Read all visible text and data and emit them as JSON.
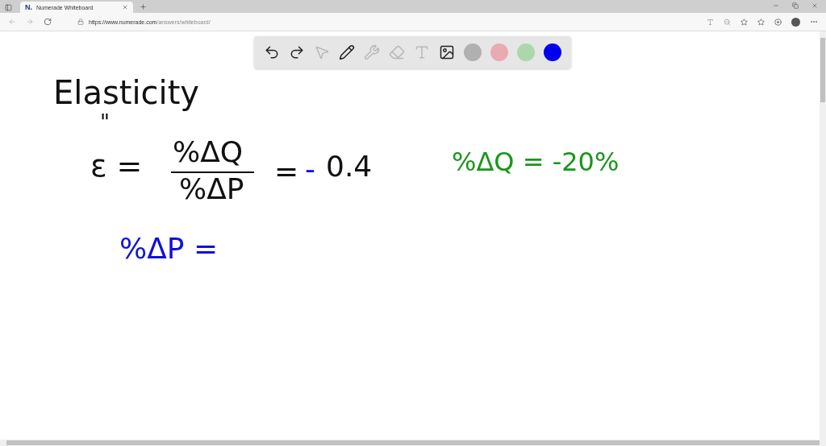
{
  "browser": {
    "tab": {
      "title": "Numerade Whiteboard",
      "logo": "N."
    },
    "url": {
      "host": "https://www.numerade.com",
      "path": "/answers/whiteboard/"
    }
  },
  "toolbar": {
    "tools": [
      {
        "kind": "undo",
        "disabled": false
      },
      {
        "kind": "redo",
        "disabled": false
      },
      {
        "kind": "select",
        "disabled": true
      },
      {
        "kind": "pen",
        "disabled": false
      },
      {
        "kind": "tools",
        "disabled": true
      },
      {
        "kind": "eraser",
        "disabled": true
      },
      {
        "kind": "text",
        "disabled": true
      },
      {
        "kind": "image",
        "disabled": false
      }
    ],
    "colors": [
      {
        "color": "#b0b0b0"
      },
      {
        "color": "#eaaab2"
      },
      {
        "color": "#acd6ac"
      },
      {
        "color": "#0000ee"
      }
    ]
  },
  "notes": [
    {
      "text": "Elasticity",
      "color": "#111111"
    },
    {
      "text": "\"",
      "color": "#111111"
    },
    {
      "text": "ε =",
      "color": "#111111"
    },
    {
      "text": "%ΔQ",
      "color": "#111111"
    },
    {
      "text": "%ΔP",
      "color": "#111111"
    },
    {
      "text": "=",
      "color": "#111111"
    },
    {
      "text": "-",
      "color": "#1010dd"
    },
    {
      "text": "0.4",
      "color": "#111111"
    },
    {
      "text": "%ΔQ  =  -20%",
      "color": "#1a961a"
    },
    {
      "text": "%ΔP =",
      "color": "#1010dd"
    }
  ]
}
